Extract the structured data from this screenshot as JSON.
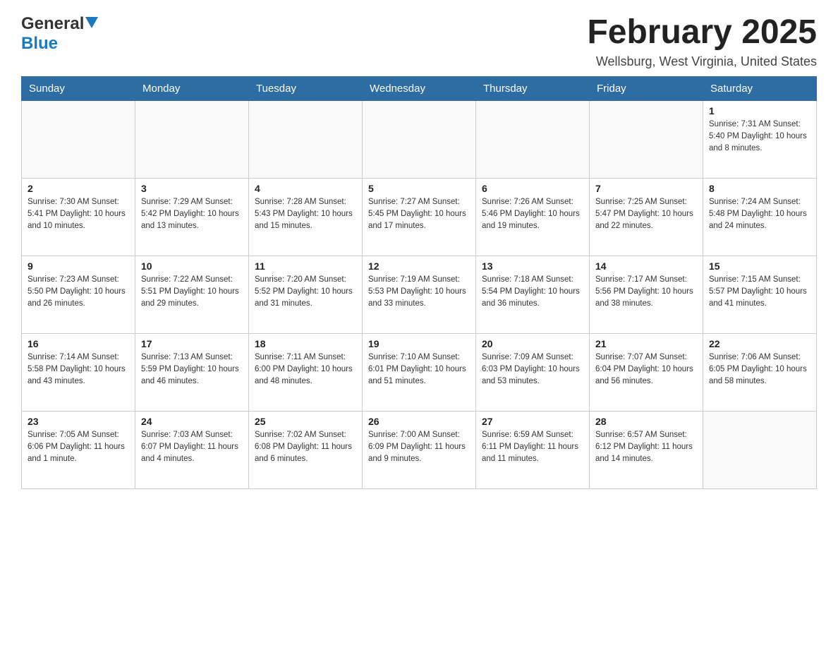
{
  "header": {
    "logo": {
      "general": "General",
      "blue": "Blue"
    },
    "title": "February 2025",
    "location": "Wellsburg, West Virginia, United States"
  },
  "calendar": {
    "days_of_week": [
      "Sunday",
      "Monday",
      "Tuesday",
      "Wednesday",
      "Thursday",
      "Friday",
      "Saturday"
    ],
    "weeks": [
      [
        {
          "day": "",
          "info": ""
        },
        {
          "day": "",
          "info": ""
        },
        {
          "day": "",
          "info": ""
        },
        {
          "day": "",
          "info": ""
        },
        {
          "day": "",
          "info": ""
        },
        {
          "day": "",
          "info": ""
        },
        {
          "day": "1",
          "info": "Sunrise: 7:31 AM\nSunset: 5:40 PM\nDaylight: 10 hours and 8 minutes."
        }
      ],
      [
        {
          "day": "2",
          "info": "Sunrise: 7:30 AM\nSunset: 5:41 PM\nDaylight: 10 hours and 10 minutes."
        },
        {
          "day": "3",
          "info": "Sunrise: 7:29 AM\nSunset: 5:42 PM\nDaylight: 10 hours and 13 minutes."
        },
        {
          "day": "4",
          "info": "Sunrise: 7:28 AM\nSunset: 5:43 PM\nDaylight: 10 hours and 15 minutes."
        },
        {
          "day": "5",
          "info": "Sunrise: 7:27 AM\nSunset: 5:45 PM\nDaylight: 10 hours and 17 minutes."
        },
        {
          "day": "6",
          "info": "Sunrise: 7:26 AM\nSunset: 5:46 PM\nDaylight: 10 hours and 19 minutes."
        },
        {
          "day": "7",
          "info": "Sunrise: 7:25 AM\nSunset: 5:47 PM\nDaylight: 10 hours and 22 minutes."
        },
        {
          "day": "8",
          "info": "Sunrise: 7:24 AM\nSunset: 5:48 PM\nDaylight: 10 hours and 24 minutes."
        }
      ],
      [
        {
          "day": "9",
          "info": "Sunrise: 7:23 AM\nSunset: 5:50 PM\nDaylight: 10 hours and 26 minutes."
        },
        {
          "day": "10",
          "info": "Sunrise: 7:22 AM\nSunset: 5:51 PM\nDaylight: 10 hours and 29 minutes."
        },
        {
          "day": "11",
          "info": "Sunrise: 7:20 AM\nSunset: 5:52 PM\nDaylight: 10 hours and 31 minutes."
        },
        {
          "day": "12",
          "info": "Sunrise: 7:19 AM\nSunset: 5:53 PM\nDaylight: 10 hours and 33 minutes."
        },
        {
          "day": "13",
          "info": "Sunrise: 7:18 AM\nSunset: 5:54 PM\nDaylight: 10 hours and 36 minutes."
        },
        {
          "day": "14",
          "info": "Sunrise: 7:17 AM\nSunset: 5:56 PM\nDaylight: 10 hours and 38 minutes."
        },
        {
          "day": "15",
          "info": "Sunrise: 7:15 AM\nSunset: 5:57 PM\nDaylight: 10 hours and 41 minutes."
        }
      ],
      [
        {
          "day": "16",
          "info": "Sunrise: 7:14 AM\nSunset: 5:58 PM\nDaylight: 10 hours and 43 minutes."
        },
        {
          "day": "17",
          "info": "Sunrise: 7:13 AM\nSunset: 5:59 PM\nDaylight: 10 hours and 46 minutes."
        },
        {
          "day": "18",
          "info": "Sunrise: 7:11 AM\nSunset: 6:00 PM\nDaylight: 10 hours and 48 minutes."
        },
        {
          "day": "19",
          "info": "Sunrise: 7:10 AM\nSunset: 6:01 PM\nDaylight: 10 hours and 51 minutes."
        },
        {
          "day": "20",
          "info": "Sunrise: 7:09 AM\nSunset: 6:03 PM\nDaylight: 10 hours and 53 minutes."
        },
        {
          "day": "21",
          "info": "Sunrise: 7:07 AM\nSunset: 6:04 PM\nDaylight: 10 hours and 56 minutes."
        },
        {
          "day": "22",
          "info": "Sunrise: 7:06 AM\nSunset: 6:05 PM\nDaylight: 10 hours and 58 minutes."
        }
      ],
      [
        {
          "day": "23",
          "info": "Sunrise: 7:05 AM\nSunset: 6:06 PM\nDaylight: 11 hours and 1 minute."
        },
        {
          "day": "24",
          "info": "Sunrise: 7:03 AM\nSunset: 6:07 PM\nDaylight: 11 hours and 4 minutes."
        },
        {
          "day": "25",
          "info": "Sunrise: 7:02 AM\nSunset: 6:08 PM\nDaylight: 11 hours and 6 minutes."
        },
        {
          "day": "26",
          "info": "Sunrise: 7:00 AM\nSunset: 6:09 PM\nDaylight: 11 hours and 9 minutes."
        },
        {
          "day": "27",
          "info": "Sunrise: 6:59 AM\nSunset: 6:11 PM\nDaylight: 11 hours and 11 minutes."
        },
        {
          "day": "28",
          "info": "Sunrise: 6:57 AM\nSunset: 6:12 PM\nDaylight: 11 hours and 14 minutes."
        },
        {
          "day": "",
          "info": ""
        }
      ]
    ]
  }
}
